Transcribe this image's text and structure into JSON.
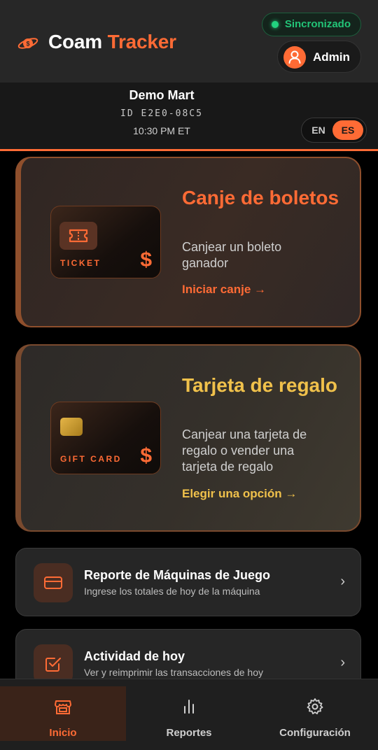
{
  "header": {
    "brand_word1": "Coam",
    "brand_word2": "Tracker",
    "sync_status": "Sincronizado",
    "user_label": "Admin"
  },
  "store": {
    "name": "Demo Mart",
    "id": "ID E2E0-08C5",
    "time": "10:30 PM ET"
  },
  "language": {
    "options": [
      "EN",
      "ES"
    ],
    "selected": "ES"
  },
  "cards": {
    "ticket": {
      "graphic_label": "TICKET",
      "currency": "$",
      "title": "Canje de boletos",
      "description": "Canjear un boleto ganador",
      "link": "Iniciar canje →"
    },
    "gift": {
      "graphic_label": "GIFT CARD",
      "currency": "$",
      "title": "Tarjeta de regalo",
      "description": "Canjear una tarjeta de regalo o vender una tarjeta de regalo",
      "link": "Elegir una opción →"
    }
  },
  "list": [
    {
      "title": "Reporte de Máquinas de Juego",
      "subtitle": "Ingrese los totales de hoy de la máquina",
      "icon": "card-icon"
    },
    {
      "title": "Actividad de hoy",
      "subtitle": "Ver y reimprimir las transacciones de hoy",
      "icon": "checkbox-icon"
    }
  ],
  "nav": {
    "items": [
      {
        "label": "Inicio",
        "icon": "store-icon",
        "active": true
      },
      {
        "label": "Reportes",
        "icon": "bar-chart-icon",
        "active": false
      },
      {
        "label": "Configuración",
        "icon": "gear-icon",
        "active": false
      }
    ]
  },
  "colors": {
    "accent": "#ff6b35",
    "gold": "#f0c14b",
    "sync_green": "#22c477",
    "background": "#000000"
  }
}
